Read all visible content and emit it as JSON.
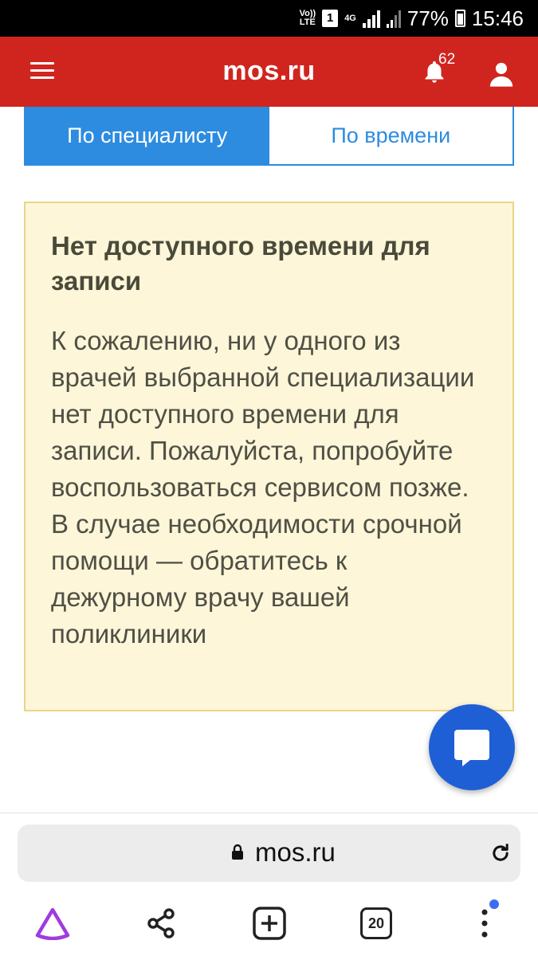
{
  "status_bar": {
    "volte_label": "Vo))\nLTE",
    "sim_label": "1",
    "network_label": "4G",
    "battery_percent": "77%",
    "time": "15:46"
  },
  "header": {
    "title": "mos.ru",
    "notification_count": "62",
    "brand_color": "#d0251f"
  },
  "tabs": [
    {
      "label": "По специалисту",
      "active": true
    },
    {
      "label": "По времени",
      "active": false
    }
  ],
  "notice": {
    "title": "Нет доступного времени для записи",
    "body": "К сожалению, ни у одного из врачей выбранной специализации нет доступного времени для записи. Пожалуйста, попробуйте воспользоваться сервисом позже. В случае необходимости срочной помощи — обратитесь к дежурному врачу вашей поликлиники"
  },
  "chat_button": {
    "icon": "chat-bubble-icon",
    "color": "#1f5fd6"
  },
  "browser": {
    "url": "mos.ru",
    "tabs_count": "20",
    "nav_icons": [
      "alice-assistant-icon",
      "share-icon",
      "new-tab-icon",
      "tabs-icon",
      "menu-icon"
    ]
  }
}
